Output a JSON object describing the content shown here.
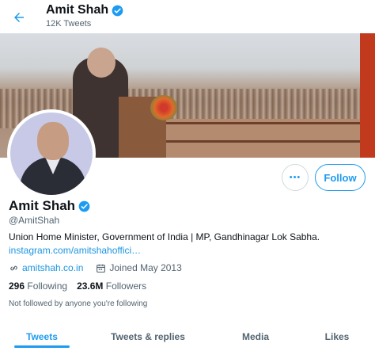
{
  "header": {
    "title": "Amit Shah",
    "tweet_count": "12K Tweets"
  },
  "profile": {
    "name": "Amit Shah",
    "handle": "@AmitShah",
    "bio": "Union Home Minister, Government of India | MP, Gandhinagar Lok Sabha.",
    "bio_link": "instagram.com/amitshahoffici…",
    "website": "amitshah.co.in",
    "joined": "Joined May 2013",
    "following_count": "296",
    "following_label": "Following",
    "followers_count": "23.6M",
    "followers_label": "Followers",
    "followed_by_note": "Not followed by anyone you're following",
    "verified": true
  },
  "actions": {
    "more_label": "•••",
    "follow_label": "Follow"
  },
  "tabs": [
    {
      "label": "Tweets",
      "active": true
    },
    {
      "label": "Tweets & replies",
      "active": false
    },
    {
      "label": "Media",
      "active": false
    },
    {
      "label": "Likes",
      "active": false
    }
  ],
  "icons": {
    "back": "arrow-left-icon",
    "verified": "verified-badge-icon",
    "link": "link-icon",
    "calendar": "calendar-icon"
  },
  "colors": {
    "accent": "#1d9bf0",
    "link": "#1b95e0",
    "secondary_text": "#536471"
  }
}
